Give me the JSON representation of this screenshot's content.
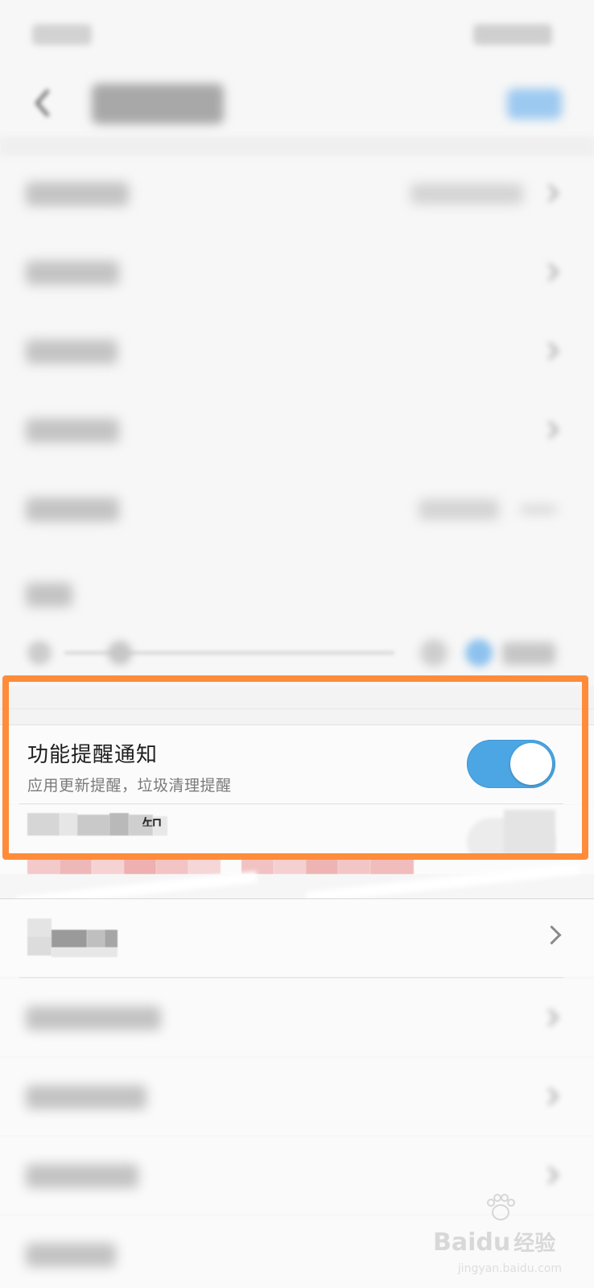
{
  "function_notice": {
    "title": "功能提醒通知",
    "subtitle": "应用更新提醒，垃圾清理提醒",
    "toggle_on": true,
    "accent_color": "#4ca6e4"
  },
  "second_notice": {
    "title_visible": "知",
    "toggle_on": false
  },
  "highlight_color": "#ff8c3a",
  "watermark": {
    "brand": "Bai",
    "brand2": "du",
    "suffix": "经验",
    "url": "jingyan.baidu.com"
  }
}
